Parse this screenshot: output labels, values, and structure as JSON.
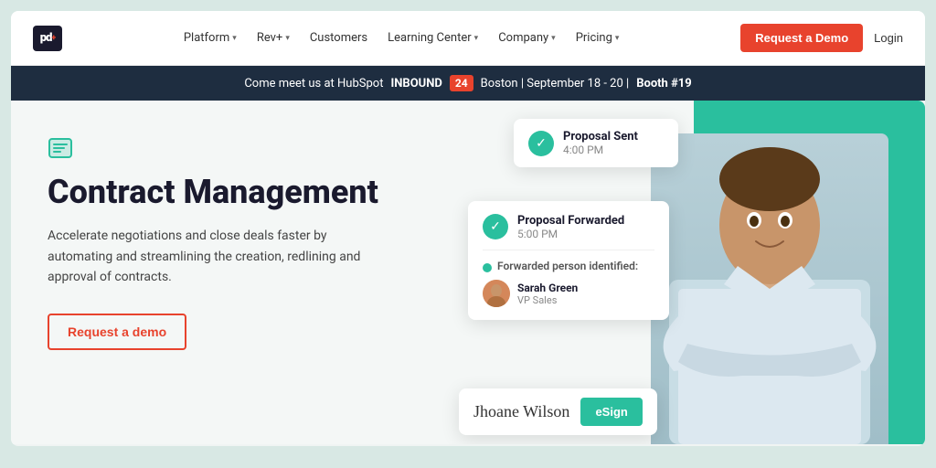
{
  "logo": {
    "text": "pd"
  },
  "navbar": {
    "items": [
      {
        "label": "Platform",
        "has_dropdown": true
      },
      {
        "label": "Rev+",
        "has_dropdown": true
      },
      {
        "label": "Customers",
        "has_dropdown": false
      },
      {
        "label": "Learning Center",
        "has_dropdown": true
      },
      {
        "label": "Company",
        "has_dropdown": true
      },
      {
        "label": "Pricing",
        "has_dropdown": true
      }
    ],
    "cta_label": "Request a Demo",
    "login_label": "Login"
  },
  "banner": {
    "prefix": "Come meet us at HubSpot",
    "brand": "INBOUND",
    "badge": "24",
    "suffix": "Boston | September 18 - 20 |",
    "booth": "Booth #19"
  },
  "hero": {
    "icon": "≡",
    "title": "Contract Management",
    "subtitle": "Accelerate negotiations and close deals faster by automating and streamlining the creation, redlining and approval of contracts.",
    "cta_label": "Request a demo"
  },
  "cards": {
    "proposal_sent": {
      "label": "Proposal Sent",
      "time": "4:00 PM"
    },
    "proposal_forwarded": {
      "label": "Proposal Forwarded",
      "time": "5:00 PM"
    },
    "forwarded_person": {
      "section_label": "Forwarded person identified:",
      "person_name": "Sarah Green",
      "person_title": "VP Sales"
    },
    "esign": {
      "signature": "Jhoane Wilson",
      "button_label": "eSign"
    }
  }
}
